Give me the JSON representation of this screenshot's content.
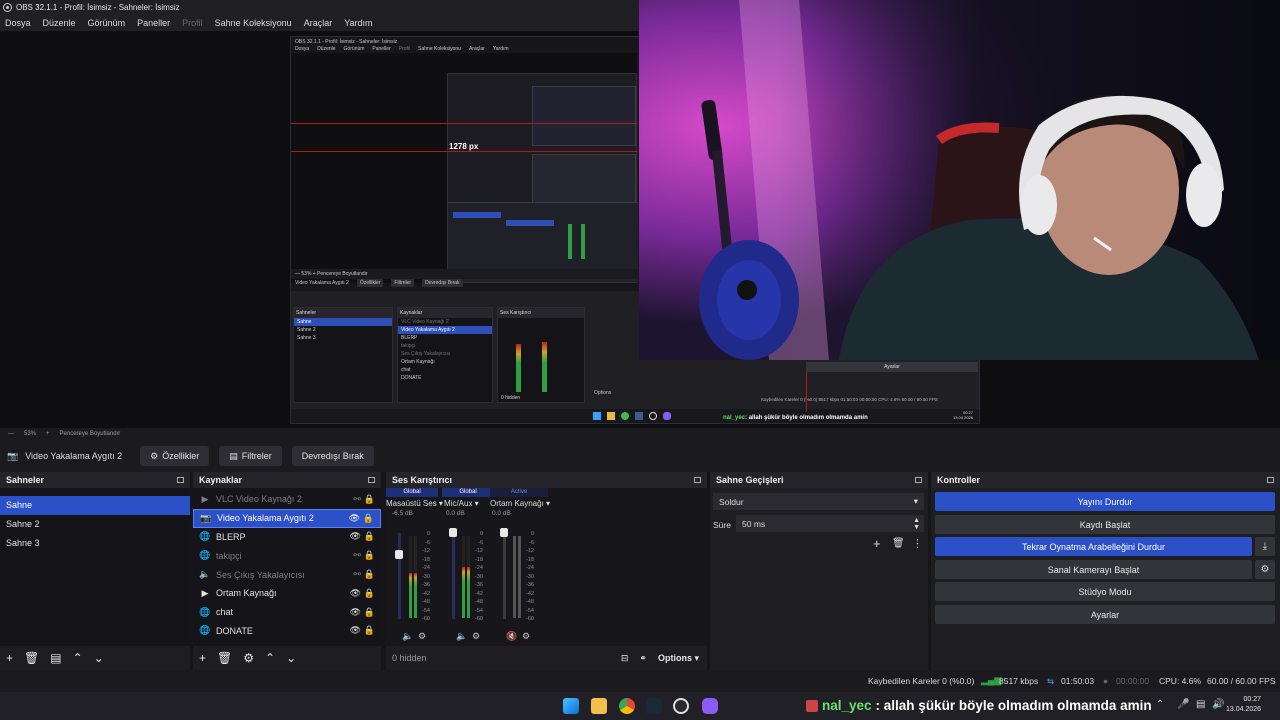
{
  "window": {
    "title": "OBS 32.1.1 - Profil: İsimsiz - Sahneler: İsimsiz"
  },
  "menu": [
    "Dosya",
    "Düzenle",
    "Görünüm",
    "Paneller",
    "Profil",
    "Sahne Koleksiyonu",
    "Araçlar",
    "Yardım"
  ],
  "nested_preview": {
    "title": "OBS 32.1.1 - Profil: İsimsiz - Sahneler: İsimsiz",
    "menu": [
      "Dosya",
      "Düzenle",
      "Görünüm",
      "Paneller",
      "Profil",
      "Sahne Koleksiyonu",
      "Araçlar",
      "Yardım"
    ],
    "width_label": "1278 px",
    "source_name": "Video Yakalama Aygıtı 2",
    "buttons": [
      "Özellikler",
      "Filtreler",
      "Devredışı Bırak"
    ],
    "scenes_title": "Sahneler",
    "scenes": [
      "Sahne",
      "Sahne 2",
      "Sahne 3"
    ],
    "sources_title": "Kaynaklar",
    "sources": [
      "VLC Video Kaynağı 2",
      "Video Yakalama Aygıtı 2",
      "BLERP",
      "takipçi",
      "Ses Çıkış Yakalayıcısı",
      "Ortam Kaynağı",
      "chat",
      "DONATE"
    ],
    "mixer_title": "Ses Karıştırıcı",
    "hidden": "0 hidden",
    "options": "Options",
    "ayarlar": "Ayarlar",
    "status": "Kaybedilen Kareler 0 (%0.0)    8517 kbps    01:50:03    00:00:00    CPU: 4.6%    60.00 / 60.00 FPS",
    "chat_user": "nal_yec",
    "chat_text": ": allah şükür böyle olmadım olmamda amin",
    "clock_time": "00:27",
    "clock_date": "13.04.2026"
  },
  "zoom_bar": {
    "zoom": "53%",
    "fit": "Pencereye Boyutlandır"
  },
  "source_bar": {
    "source_name": "Video Yakalama Aygıtı 2",
    "properties": "Özellikler",
    "filters": "Filtreler",
    "disable": "Devredışı Bırak"
  },
  "scenes": {
    "title": "Sahneler",
    "items": [
      "Sahne",
      "Sahne 2",
      "Sahne 3"
    ],
    "selected": 0
  },
  "sources": {
    "title": "Kaynaklar",
    "items": [
      {
        "name": "VLC Video Kaynağı 2",
        "icon": "play-icon",
        "visible": false
      },
      {
        "name": "Video Yakalama Aygıtı 2",
        "icon": "camera-icon",
        "visible": true,
        "selected": true
      },
      {
        "name": "BLERP",
        "icon": "globe-icon",
        "visible": true
      },
      {
        "name": "takipçi",
        "icon": "globe-icon",
        "visible": false
      },
      {
        "name": "Ses Çıkış Yakalayıcısı",
        "icon": "speaker-icon",
        "visible": false
      },
      {
        "name": "Ortam Kaynağı",
        "icon": "play-icon",
        "visible": true
      },
      {
        "name": "chat",
        "icon": "globe-icon",
        "visible": true
      },
      {
        "name": "DONATE",
        "icon": "globe-icon",
        "visible": true
      }
    ]
  },
  "mixer": {
    "title": "Ses Karıştırıcı",
    "channels": [
      {
        "tag": "Global",
        "name": "Masaüstü Ses",
        "db": "-6.5 dB",
        "level": 0.55,
        "fader": 0.88,
        "muted": false
      },
      {
        "tag": "Global",
        "name": "Mic/Aux",
        "db": "0.0 dB",
        "level": 0.62,
        "fader": 1.0,
        "muted": false
      },
      {
        "tag": "Active",
        "name": "Ortam Kaynağı",
        "db": "0.0 dB",
        "level": 0.0,
        "fader": 1.0,
        "muted": true
      }
    ],
    "scale": [
      "0",
      "-6",
      "-12",
      "-18",
      "-24",
      "-30",
      "-36",
      "-42",
      "-48",
      "-54",
      "-60"
    ],
    "hidden": "0 hidden",
    "options": "Options"
  },
  "transitions": {
    "title": "Sahne Geçişleri",
    "type": "Soldur",
    "duration_label": "Süre",
    "duration": "50 ms"
  },
  "controls": {
    "title": "Kontroller",
    "buttons": [
      {
        "label": "Yayını Durdur",
        "active": true
      },
      {
        "label": "Kaydı Başlat",
        "active": false
      },
      {
        "label": "Tekrar Oynatma Arabelleğini Durdur",
        "active": true
      },
      {
        "label": "Sanal Kamerayı Başlat",
        "active": false
      },
      {
        "label": "Stüdyo Modu",
        "active": false
      },
      {
        "label": "Ayarlar",
        "active": false
      }
    ]
  },
  "status": {
    "dropped": "Kaybedilen Kareler 0 (%0.0)",
    "bitrate": "8517 kbps",
    "stream_time": "01:50:03",
    "rec_time": "00:00:00",
    "cpu": "CPU: 4.6%",
    "fps": "60.00 / 60.00 FPS"
  },
  "chat": {
    "user": "nal_yec",
    "text": ": allah şükür böyle olmadım olmamda amin"
  },
  "clock": {
    "time": "00:27",
    "date": "13.04.2026"
  },
  "colors": {
    "accent": "#2c50c8",
    "panel": "#1d1d22",
    "meter_green": "#2ea043",
    "chat_user": "#6be06b"
  }
}
